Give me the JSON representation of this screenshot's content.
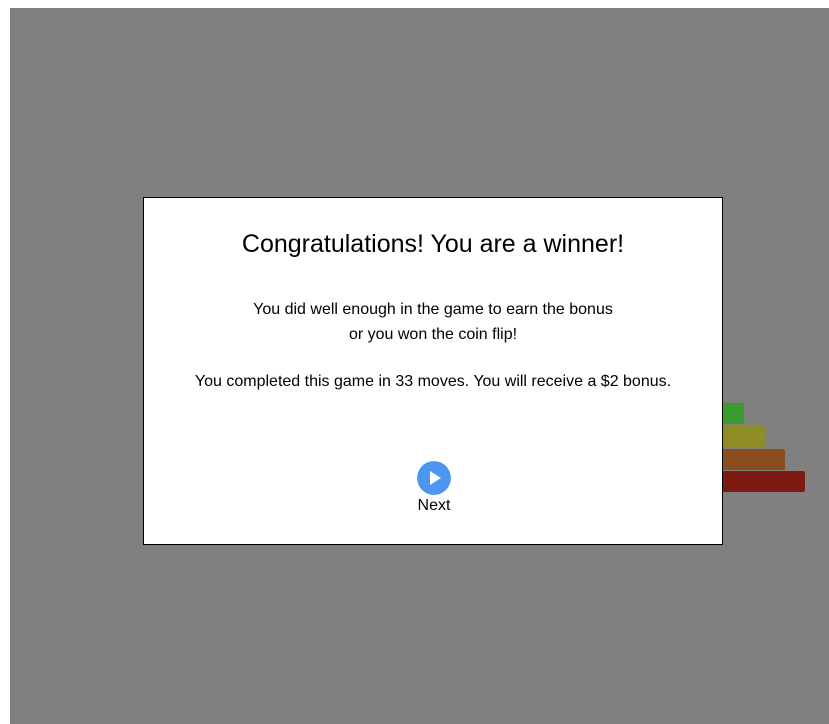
{
  "background": {
    "color": "#808080",
    "disks": [
      {
        "color": "#3a9b2f"
      },
      {
        "color": "#8f8e25"
      },
      {
        "color": "#8a4d1f"
      },
      {
        "color": "#7d1a12"
      }
    ]
  },
  "modal": {
    "title": "Congratulations! You are a winner!",
    "message_line1": "You did well enough in the game to earn the bonus",
    "message_line2": "or you won the coin flip!",
    "result": "You completed this game in 33 moves. You will receive a $2 bonus.",
    "next_button": {
      "label": "Next",
      "icon": "play-circle-icon",
      "color": "#4b96f0"
    }
  }
}
